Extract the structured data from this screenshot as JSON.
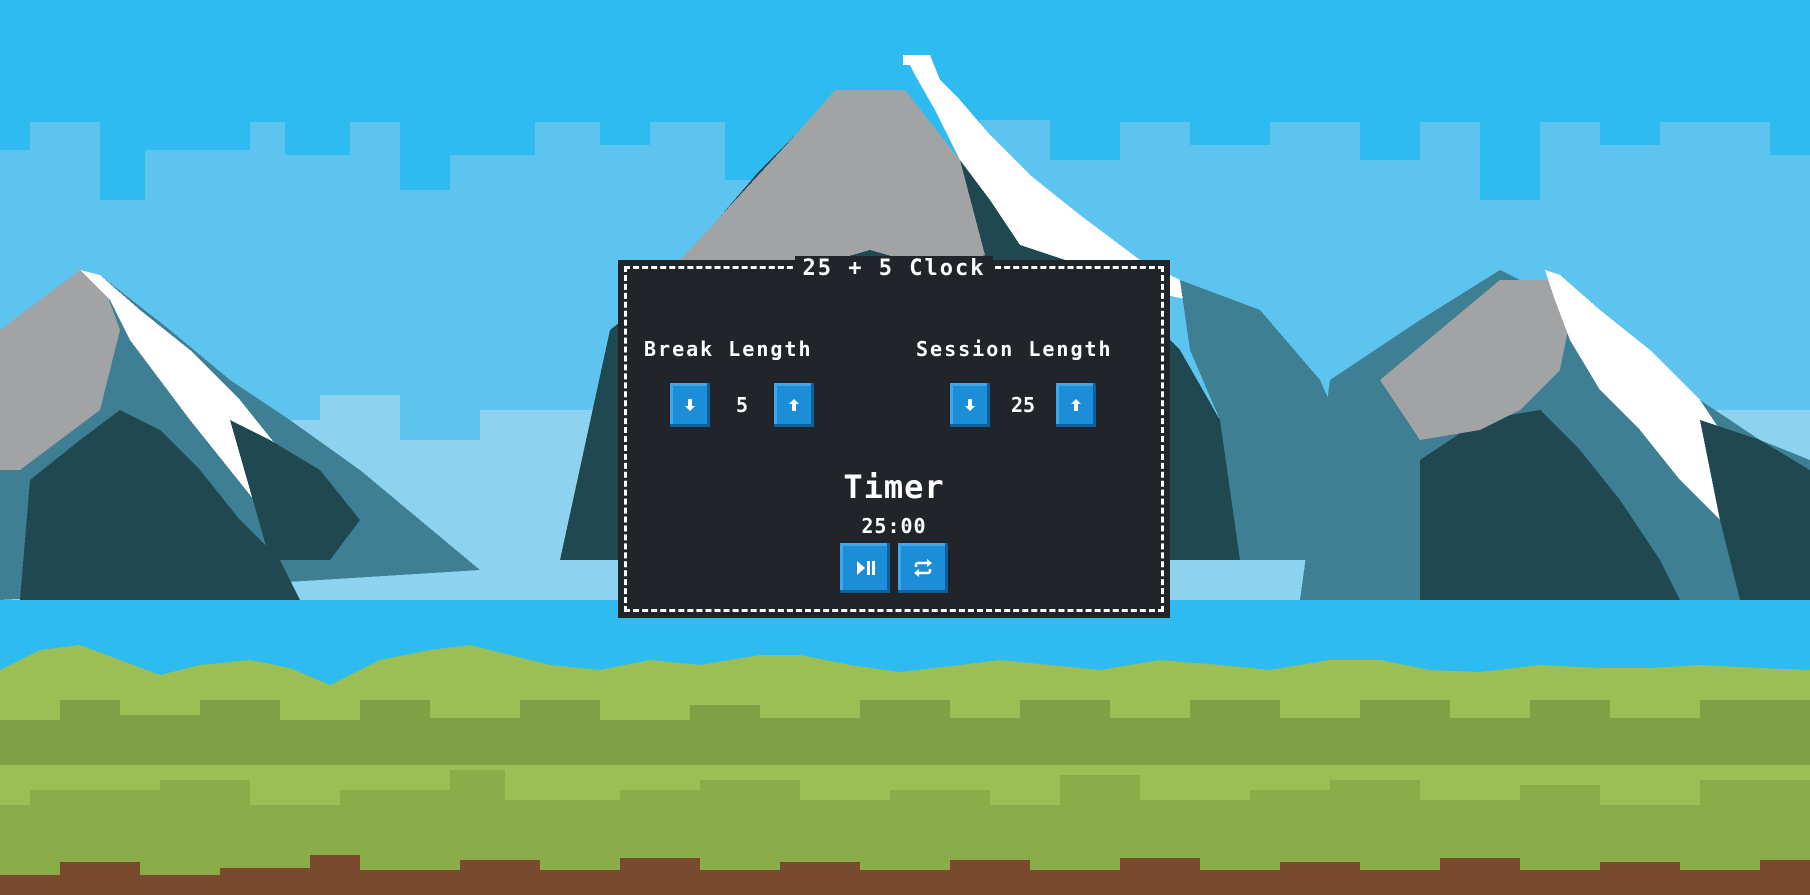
{
  "title": "25 + 5 Clock",
  "break": {
    "label": "Break Length",
    "value": "5",
    "decrement_icon": "arrow-down-icon",
    "increment_icon": "arrow-up-icon"
  },
  "session": {
    "label": "Session Length",
    "value": "25",
    "decrement_icon": "arrow-down-icon",
    "increment_icon": "arrow-up-icon"
  },
  "timer": {
    "label": "Timer",
    "time_left": "25:00",
    "start_stop_icon": "play-pause-icon",
    "reset_icon": "refresh-icon"
  },
  "colors": {
    "sky": "#2ebbef",
    "panel": "#212429",
    "button": "#1c8ed8",
    "text": "#ffffff",
    "grass": "#8fb24a",
    "dirt": "#7a4a2e"
  }
}
